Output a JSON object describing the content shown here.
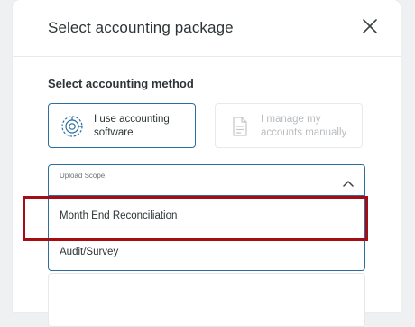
{
  "modal": {
    "title": "Select accounting package"
  },
  "method_section": {
    "label": "Select accounting method",
    "options": [
      {
        "label": "I use accounting software",
        "icon": "accounting-software-icon",
        "selected": true
      },
      {
        "label": "I manage my accounts manually",
        "icon": "document-icon",
        "selected": false
      }
    ]
  },
  "upload_scope": {
    "label": "Upload Scope",
    "options": [
      {
        "label": "Month End Reconciliation"
      },
      {
        "label": "Audit/Survey"
      }
    ],
    "highlighted_option": "Month End Reconciliation"
  },
  "colors": {
    "accent": "#2c6e9e",
    "highlight_border": "#a50d15",
    "disabled_text": "#b7bcc0"
  }
}
